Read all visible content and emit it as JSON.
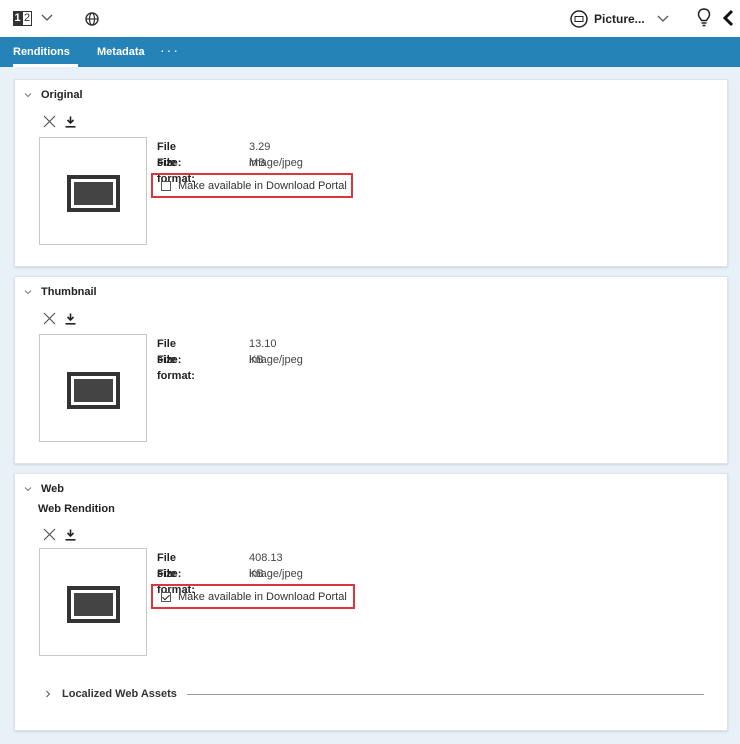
{
  "toolbar": {
    "number_digits": [
      "1",
      "2"
    ],
    "picture_label": "Picture...",
    "icons": [
      "number-format-icon",
      "chevron-down-icon",
      "globe-icon",
      "picture-icon",
      "lightbulb-icon",
      "back-icon"
    ]
  },
  "tabs": [
    {
      "label": "Renditions",
      "active": true
    },
    {
      "label": "Metadata",
      "active": false
    }
  ],
  "tabs_more": "···",
  "sections": {
    "original": {
      "title": "Original",
      "file_size_label": "File size:",
      "file_size": "3.29 MB",
      "file_format_label": "File format:",
      "file_format": "image/jpeg",
      "portal_label": "Make available in Download Portal",
      "portal_checked": false
    },
    "thumbnail": {
      "title": "Thumbnail",
      "file_size_label": "File size:",
      "file_size": "13.10 KB",
      "file_format_label": "File format:",
      "file_format": "image/jpeg"
    },
    "web": {
      "title": "Web",
      "subtitle": "Web Rendition",
      "file_size_label": "File size:",
      "file_size": "408.13 KB",
      "file_format_label": "File format:",
      "file_format": "image/jpeg",
      "portal_label": "Make available in Download Portal",
      "portal_checked": true,
      "localized_label": "Localized Web Assets"
    }
  },
  "colors": {
    "tab_bar": "#2583b7",
    "highlight_border": "#d9363e",
    "content_bg": "#e8f1f7"
  }
}
